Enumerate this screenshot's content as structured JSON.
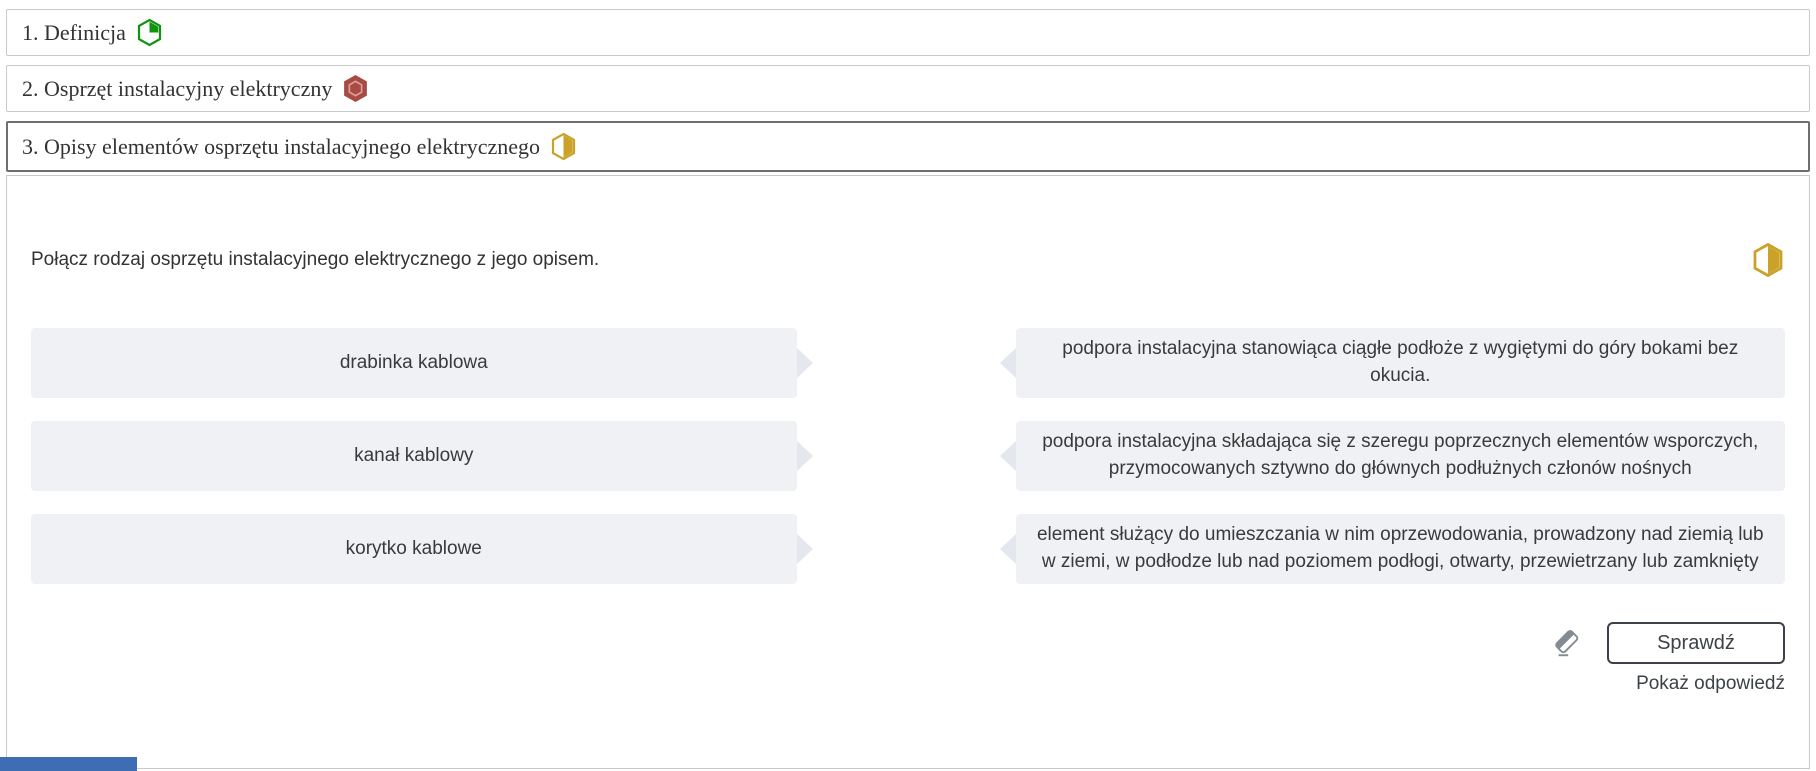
{
  "accordion": {
    "items": [
      {
        "label": "1. Definicja",
        "icon": "hexagon-wedge-icon",
        "state": "collapsed"
      },
      {
        "label": "2. Osprzęt instalacyjny elektryczny",
        "icon": "hexagon-filled-icon",
        "state": "collapsed"
      },
      {
        "label": "3. Opisy elementów osprzętu instalacyjnego elektrycznego",
        "icon": "hexagon-half-icon",
        "state": "expanded"
      }
    ]
  },
  "exercise": {
    "prompt": "Połącz rodzaj osprzętu instalacyjnego elektrycznego z jego opisem.",
    "difficulty_icon": "hexagon-half-icon",
    "pairs": [
      {
        "left": "drabinka kablowa",
        "right": "podpora instalacyjna stanowiąca ciągłe podłoże z wygiętymi do góry bokami bez okucia."
      },
      {
        "left": "kanał kablowy",
        "right": "podpora instalacyjna składająca się z szeregu poprzecznych elementów wsporczych, przymocowanych sztywno do głównych podłużnych członów nośnych"
      },
      {
        "left": "korytko kablowe",
        "right": "element służący do umieszczania w nim oprzewodowania, prowadzony nad ziemią lub w ziemi, w podłodze lub nad poziomem podłogi, otwarty, przewietrzany lub zamknięty"
      }
    ],
    "actions": {
      "check_label": "Sprawdź",
      "show_answer_label": "Pokaż odpowiedź",
      "eraser_icon": "eraser-icon"
    }
  },
  "colors": {
    "icon_green": "#12930f",
    "icon_red": "#a84b43",
    "icon_red_inner": "#d9a19a",
    "icon_yellow": "#c9a227",
    "eraser_gray": "#858b92",
    "item_bg": "#f0f1f5",
    "connector_gray": "#e4e7ee",
    "border_light": "#c9c9c9",
    "border_active": "#6f6f6f",
    "button_border": "#3d4248",
    "blue_strip": "#3e6db4"
  }
}
